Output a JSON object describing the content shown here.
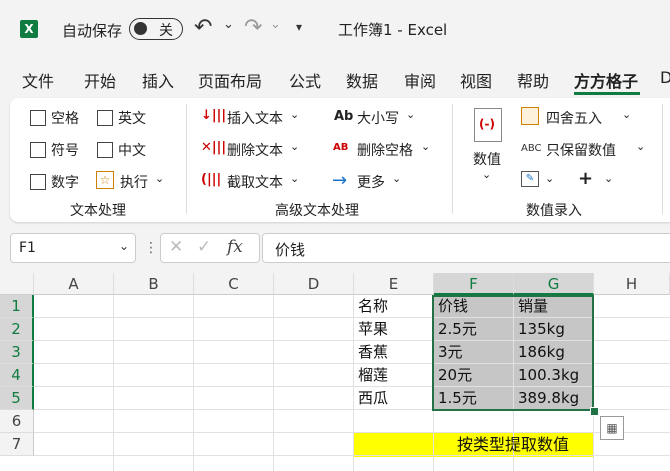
{
  "titlebar": {
    "logo": "X",
    "autosave_label": "自动保存",
    "autosave_state": "关",
    "undo_icon": "↶",
    "redo_icon": "↷",
    "dropdown_icon": "⌄",
    "customize_icon": "▾",
    "title": "工作簿1 - Excel"
  },
  "menu": {
    "tabs": [
      "文件",
      "开始",
      "插入",
      "页面布局",
      "公式",
      "数据",
      "审阅",
      "视图",
      "帮助",
      "方方格子",
      "D"
    ]
  },
  "ribbon": {
    "text_group": {
      "items": [
        "空格",
        "英文",
        "符号",
        "中文",
        "数字",
        "执行"
      ],
      "label": "文本处理"
    },
    "advanced_group": {
      "insert": "插入文本",
      "delete": "删除文本",
      "extract": "截取文本",
      "case": "大小写",
      "delete_space": "删除空格",
      "more": "更多",
      "label": "高级文本处理",
      "case_icon": "Ab",
      "delete_space_icon": "AB"
    },
    "value_group": {
      "value": "数值",
      "round": "四舍五入",
      "keep_value": "只保留数值",
      "label": "数值录入",
      "keep_value_icon": "ABC"
    },
    "symbols": {
      "plus": "+",
      "chevron": "⌄"
    }
  },
  "formula_bar": {
    "name_box": "F1",
    "fx": "fx",
    "content": "价钱"
  },
  "sheet": {
    "columns": [
      "A",
      "B",
      "C",
      "D",
      "E",
      "F",
      "G",
      "H"
    ],
    "rows": [
      "1",
      "2",
      "3",
      "4",
      "5",
      "6",
      "7"
    ],
    "cells": {
      "E1": "名称",
      "F1": "价钱",
      "G1": "销量",
      "E2": "苹果",
      "F2": "2.5元",
      "G2": "135kg",
      "E3": "香蕉",
      "F3": "3元",
      "G3": "186kg",
      "E4": "榴莲",
      "F4": "20元",
      "G4": "100.3kg",
      "E5": "西瓜",
      "F5": "1.5元",
      "G5": "389.8kg",
      "E7": "按类型提取数值"
    },
    "selected_columns": [
      "F",
      "G"
    ],
    "selected_rows": [
      "1",
      "2",
      "3",
      "4",
      "5"
    ],
    "highlight_color": "#ffff00",
    "accent": "#107c41"
  }
}
